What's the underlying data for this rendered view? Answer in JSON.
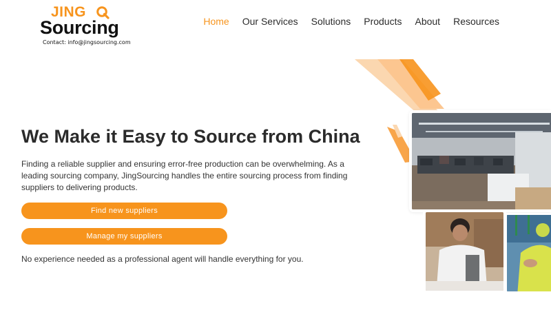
{
  "brand": {
    "logo_top": "JINGQ",
    "logo_bottom": "Sourcing",
    "contact": "Contact: info@jingsourcing.com",
    "accent_color": "#f7941d"
  },
  "nav": {
    "items": [
      {
        "label": "Home",
        "active": true
      },
      {
        "label": "Our Services",
        "active": false
      },
      {
        "label": "Solutions",
        "active": false
      },
      {
        "label": "Products",
        "active": false
      },
      {
        "label": "About",
        "active": false
      },
      {
        "label": "Resources",
        "active": false
      }
    ]
  },
  "hero": {
    "title": "We Make it Easy to Source from China",
    "description": "Finding a reliable supplier and ensuring error-free production can be overwhelming. As a leading sourcing company, JingSourcing handles the entire sourcing process from finding suppliers to delivering products.",
    "primary_button": "Find new suppliers",
    "secondary_button": "Manage my suppliers",
    "note": "No experience needed as a professional agent will handle everything for you."
  },
  "images": {
    "main": "office-photo",
    "small_left": "worker-inspection-photo",
    "small_right": "worker-yellow-vest-photo"
  }
}
